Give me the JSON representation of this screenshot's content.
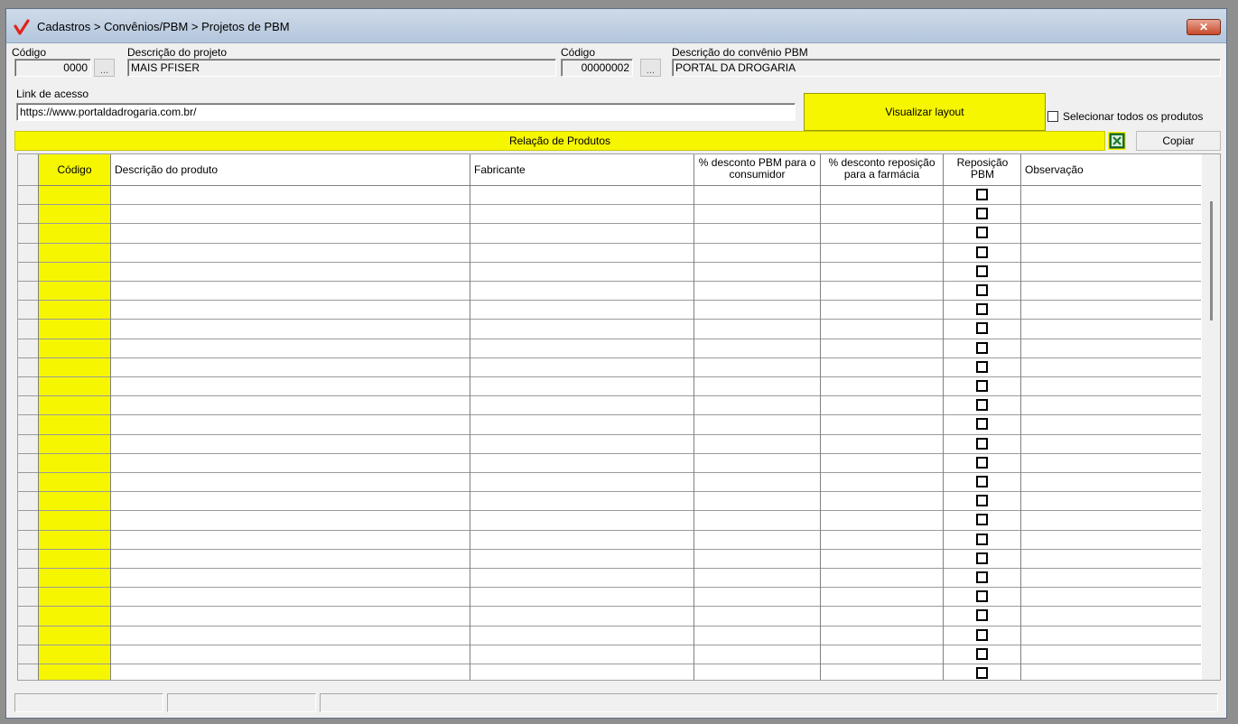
{
  "window": {
    "title": "Cadastros > Convênios/PBM > Projetos de PBM",
    "close_label": "✕"
  },
  "form": {
    "codigo_label": "Código",
    "codigo_value": "0000",
    "descricao_projeto_label": "Descrição do projeto",
    "descricao_projeto_value": "MAIS PFISER",
    "codigo_convenio_label": "Código",
    "codigo_convenio_value": "00000002",
    "descricao_convenio_label": "Descrição do convênio PBM",
    "descricao_convenio_value": "PORTAL DA DROGARIA",
    "ellipsis_label": "...",
    "link_label": "Link de acesso",
    "link_value": "https://www.portaldadrogaria.com.br/"
  },
  "actions": {
    "visualizar_layout": "Visualizar layout",
    "selecionar_todos": "Selecionar todos os produtos",
    "copiar": "Copiar",
    "excel_icon": "excel-export-icon"
  },
  "section_title": "Relação de Produtos",
  "table": {
    "columns": [
      {
        "key": "codigo",
        "label": "Código"
      },
      {
        "key": "descricao",
        "label": "Descrição do produto"
      },
      {
        "key": "fabricante",
        "label": "Fabricante"
      },
      {
        "key": "desc_consumidor",
        "label": "% desconto PBM para o consumidor"
      },
      {
        "key": "desc_farmacia",
        "label": "% desconto reposição para a farmácia"
      },
      {
        "key": "reposicao",
        "label": "Reposição PBM"
      },
      {
        "key": "observacao",
        "label": "Observação"
      }
    ],
    "row_count": 26
  },
  "colors": {
    "highlight_yellow": "#f6f600",
    "window_bg": "#f0f0f0"
  }
}
